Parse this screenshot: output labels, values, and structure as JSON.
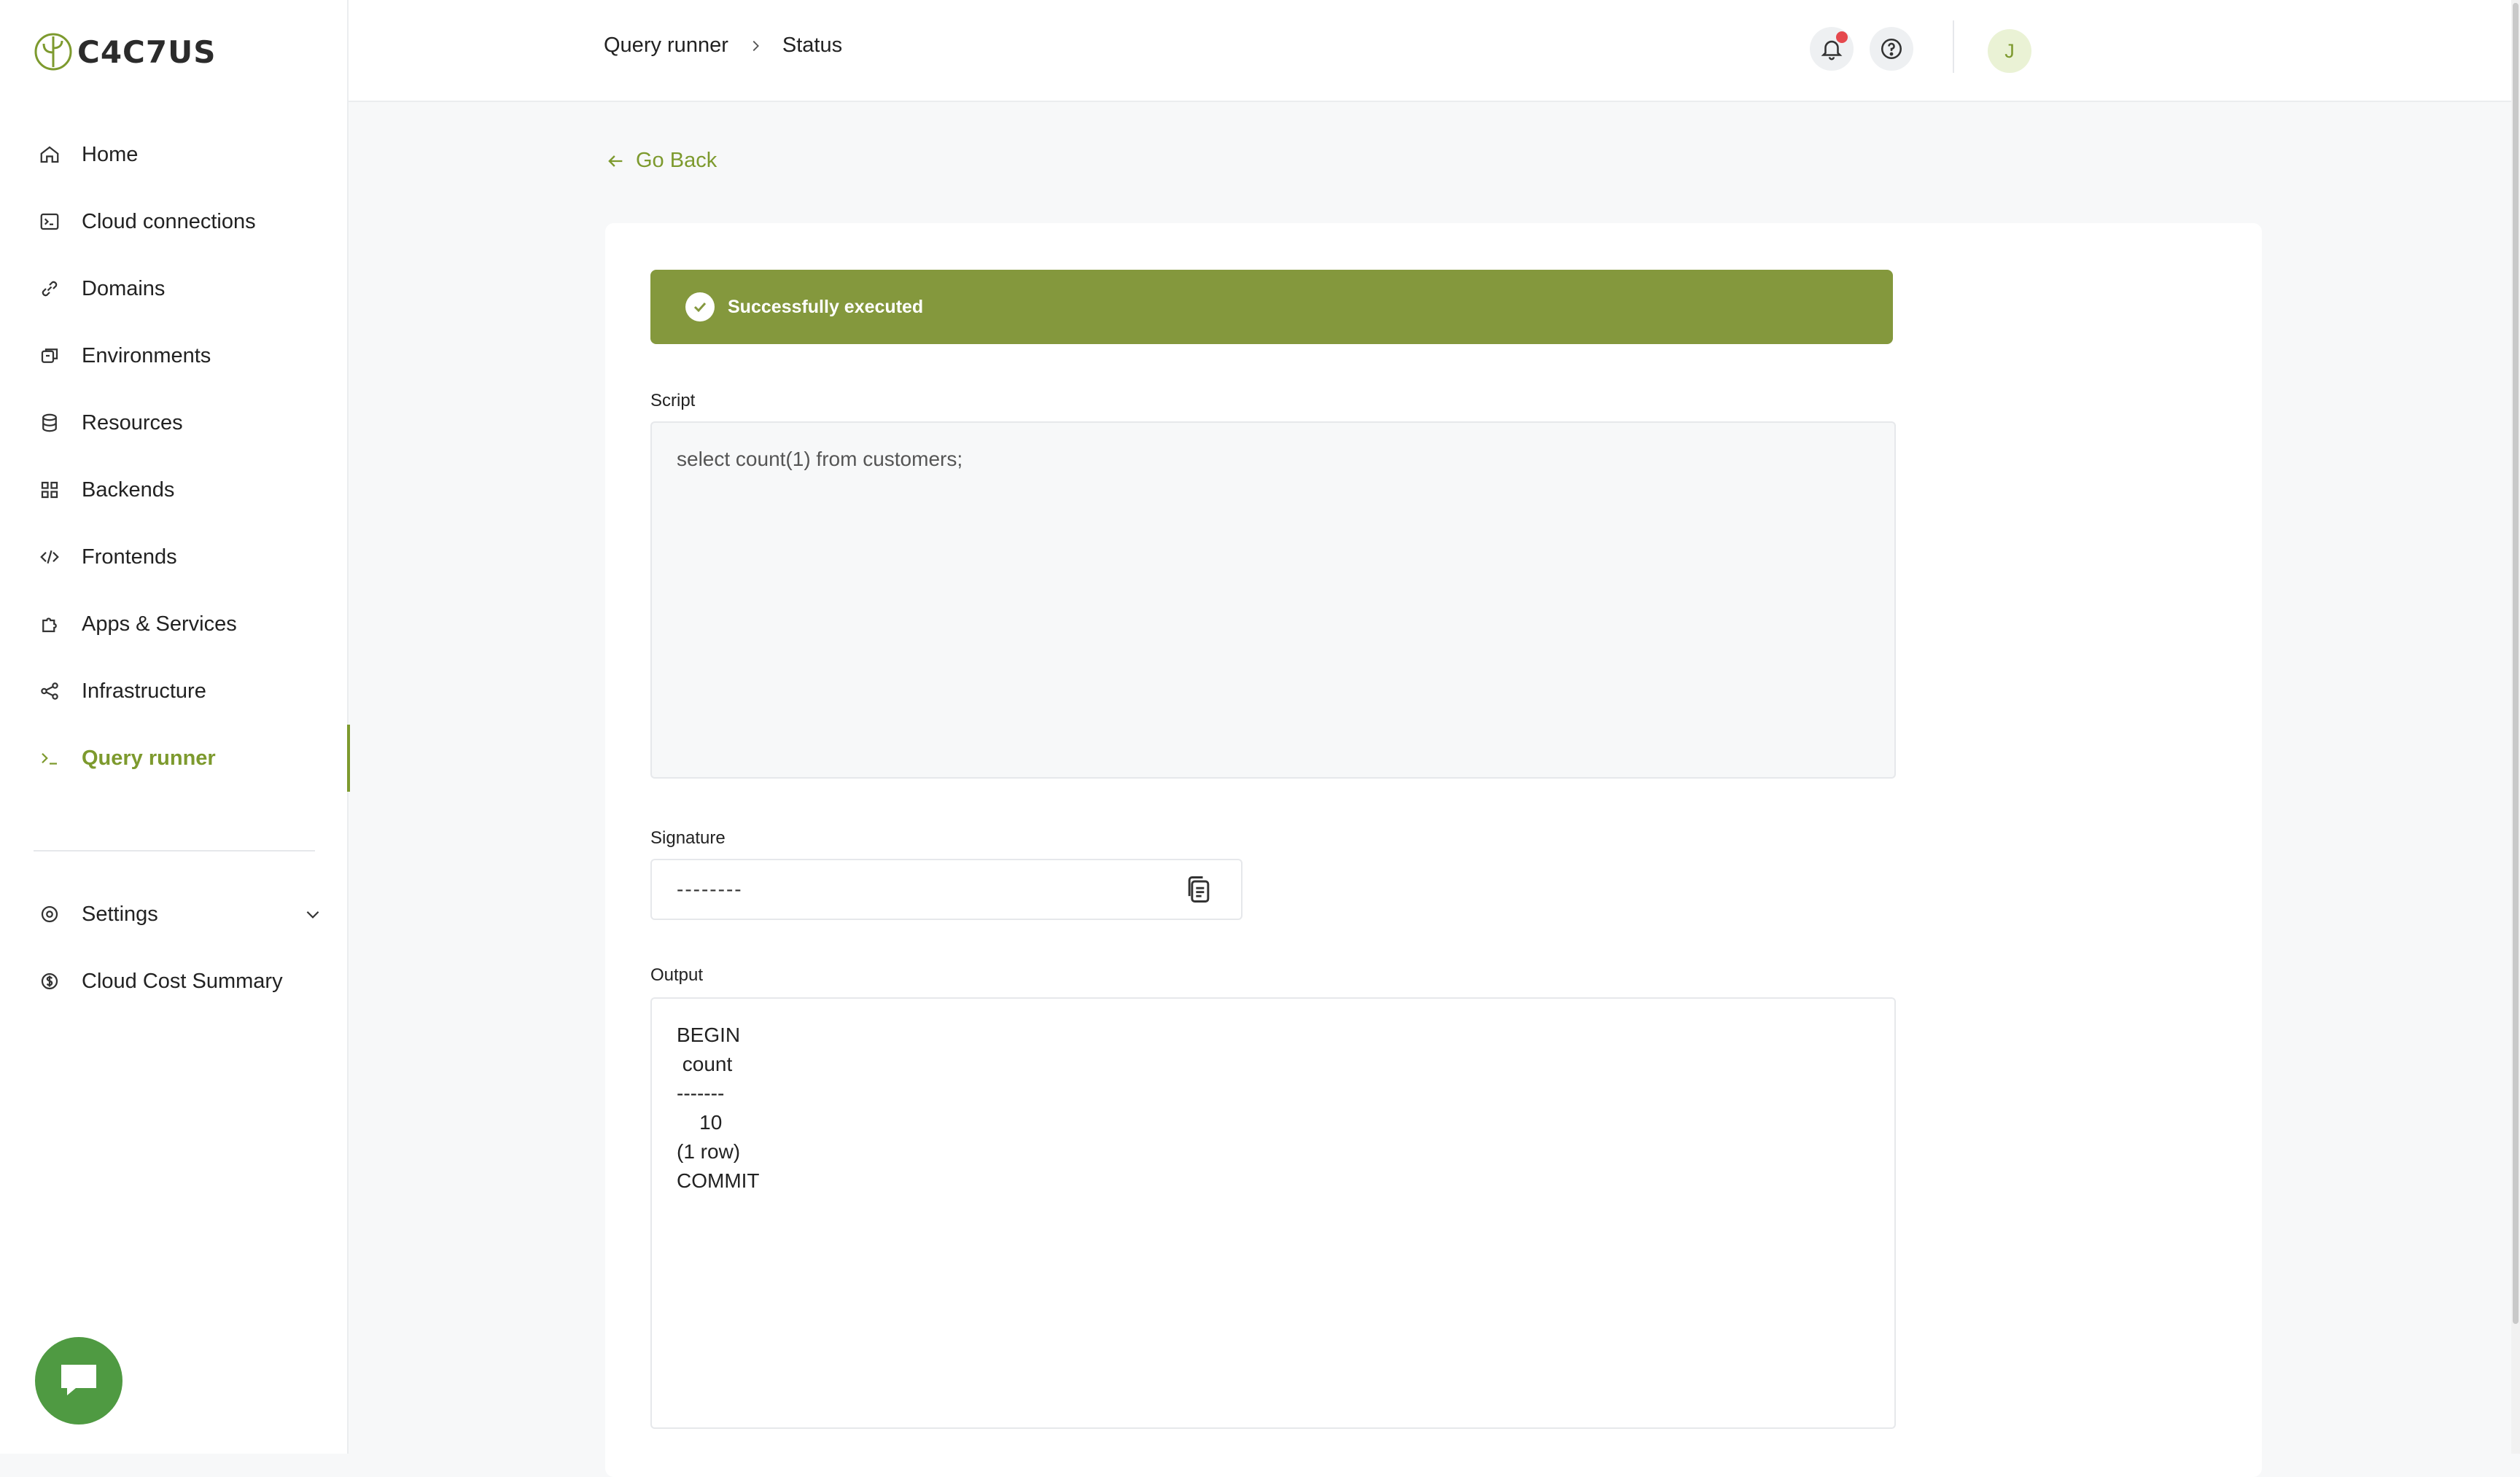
{
  "brand": {
    "name": "C4C7US",
    "accent": "#7d9a2e"
  },
  "sidebar": {
    "items": [
      {
        "label": "Home",
        "icon": "home-icon"
      },
      {
        "label": "Cloud connections",
        "icon": "terminal-box-icon"
      },
      {
        "label": "Domains",
        "icon": "link-icon"
      },
      {
        "label": "Environments",
        "icon": "environments-icon"
      },
      {
        "label": "Resources",
        "icon": "database-icon"
      },
      {
        "label": "Backends",
        "icon": "grid-icon"
      },
      {
        "label": "Frontends",
        "icon": "code-icon"
      },
      {
        "label": "Apps & Services",
        "icon": "puzzle-icon"
      },
      {
        "label": "Infrastructure",
        "icon": "share-nodes-icon"
      },
      {
        "label": "Query runner",
        "icon": "terminal-prompt-icon",
        "active": true
      }
    ],
    "bottom_items": [
      {
        "label": "Settings",
        "icon": "gear-icon"
      },
      {
        "label": "Cloud Cost Summary",
        "icon": "dollar-circle-icon"
      }
    ]
  },
  "header": {
    "breadcrumb": [
      "Query runner",
      "Status"
    ],
    "avatar_initial": "J"
  },
  "page": {
    "go_back": "Go Back",
    "status_banner": {
      "text": "Successfully executed",
      "color": "#84983d"
    },
    "script": {
      "label": "Script",
      "value": "select count(1) from customers;"
    },
    "signature": {
      "label": "Signature",
      "value": "--------"
    },
    "output": {
      "label": "Output",
      "lines": [
        "BEGIN",
        " count",
        "-------",
        "    10",
        "(1 row)",
        "",
        "COMMIT"
      ]
    }
  }
}
